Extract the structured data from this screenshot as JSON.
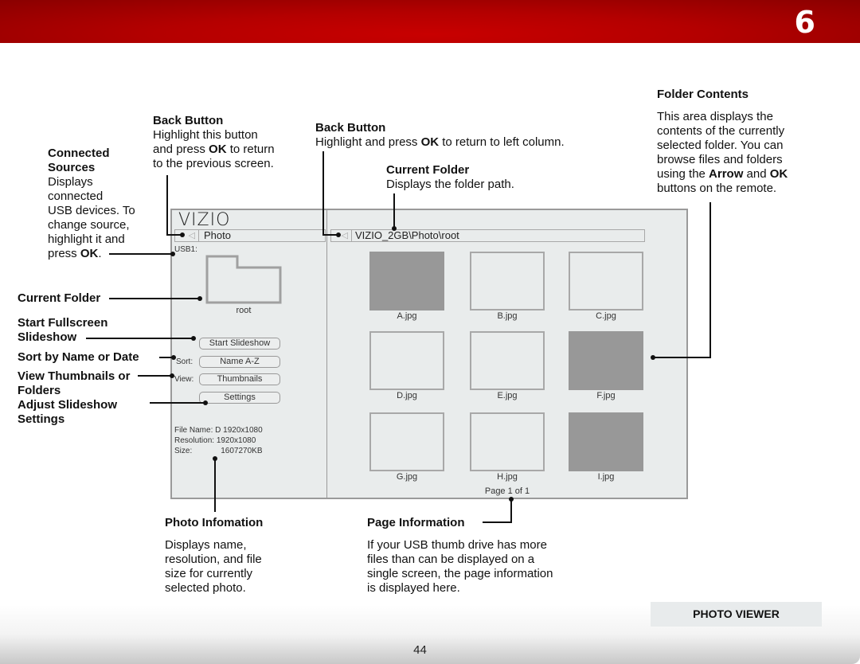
{
  "header": {
    "chapter": "6"
  },
  "footer": {
    "section": "PHOTO VIEWER",
    "page_number": "44"
  },
  "callouts": {
    "back_button_left": {
      "title": "Back Button",
      "body_1": "Highlight this button",
      "body_2a": "and press ",
      "body_2b": "OK",
      "body_2c": " to return",
      "body_3": "to the previous screen."
    },
    "connected_sources": {
      "title_1": "Connected",
      "title_2": "Sources",
      "body_1": "Displays",
      "body_2": "connected",
      "body_3": "USB devices. To",
      "body_4": "change source,",
      "body_5": "highlight it and",
      "body_6a": "press ",
      "body_6b": "OK",
      "body_6c": "."
    },
    "back_button_right": {
      "title": "Back Button",
      "body_a": "Highlight and press ",
      "body_b": "OK",
      "body_c": " to return to left column."
    },
    "current_folder_path": {
      "title": "Current Folder",
      "body": "Displays the folder path."
    },
    "folder_contents": {
      "title": "Folder Contents",
      "body_1": "This area displays the",
      "body_2": "contents of the currently",
      "body_3": "selected folder. You can",
      "body_4": "browse files and folders",
      "body_5a": "using the ",
      "body_5b": "Arrow",
      "body_5c": " and ",
      "body_5d": "OK",
      "body_6": "buttons on the remote."
    },
    "current_folder": {
      "title": "Current Folder"
    },
    "start_slideshow": {
      "title_1": "Start Fullscreen",
      "title_2": "Slideshow"
    },
    "sort": {
      "title": "Sort by Name or Date"
    },
    "view": {
      "title_1": "View Thumbnails or",
      "title_2": "Folders"
    },
    "settings": {
      "title_1": "Adjust Slideshow",
      "title_2": "Settings"
    },
    "photo_info": {
      "title": "Photo Infomation",
      "body_1": "Displays name,",
      "body_2": "resolution, and file",
      "body_3": "size for currently",
      "body_4": "selected photo."
    },
    "page_info": {
      "title": "Page Information",
      "body_1": "If your USB thumb drive has more",
      "body_2": "files than can be displayed on a",
      "body_3": "single screen, the page information",
      "body_4": "is displayed here."
    }
  },
  "screen": {
    "logo": "VIZIO",
    "left_nav": {
      "back_icon": "◁",
      "label": "Photo"
    },
    "right_nav": {
      "back_icon": "◁",
      "path": "VIZIO_2GB\\Photo\\root"
    },
    "source_label": "USB1:",
    "folder_name": "root",
    "buttons": {
      "start_slideshow": "Start Slideshow",
      "sort_label": "Sort:",
      "sort_value": "Name A-Z",
      "view_label": "View:",
      "view_value": "Thumbnails",
      "settings": "Settings"
    },
    "file_info": {
      "name_label": "File Name:",
      "name_value": "D 1920x1080",
      "resolution_label": "Resolution:",
      "resolution_value": "1920x1080",
      "size_label": "Size:",
      "size_value": "1607270KB"
    },
    "thumbnails": [
      {
        "name": "A.jpg",
        "filled": true
      },
      {
        "name": "B.jpg",
        "filled": false
      },
      {
        "name": "C.jpg",
        "filled": false
      },
      {
        "name": "D.jpg",
        "filled": false
      },
      {
        "name": "E.jpg",
        "filled": false
      },
      {
        "name": "F.jpg",
        "filled": true
      },
      {
        "name": "G.jpg",
        "filled": false
      },
      {
        "name": "H.jpg",
        "filled": false
      },
      {
        "name": "I.jpg",
        "filled": true
      }
    ],
    "page_info": "Page 1 of 1"
  }
}
